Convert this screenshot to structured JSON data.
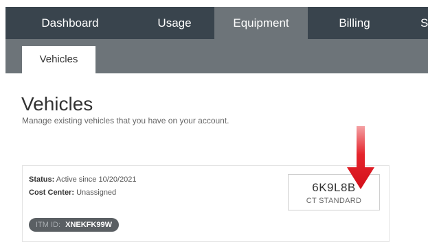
{
  "nav": {
    "tabs": [
      {
        "label": "Dashboard"
      },
      {
        "label": "Usage"
      },
      {
        "label": "Equipment",
        "active": true
      },
      {
        "label": "Billing"
      },
      {
        "label": "S"
      }
    ],
    "active_color": "#6d7479",
    "bar_color": "#39444d"
  },
  "subnav": {
    "tabs": [
      {
        "label": "Vehicles",
        "active": true
      }
    ]
  },
  "page": {
    "title": "Vehicles",
    "subtitle": "Manage existing vehicles that you have on your account."
  },
  "vehicle": {
    "status_label": "Status:",
    "status_value": "Active since 10/20/2021",
    "cost_center_label": "Cost Center:",
    "cost_center_value": "Unassigned",
    "plate": "6K9L8B",
    "plate_type": "CT STANDARD",
    "itm_label": "ITM ID:",
    "itm_value": "XNEKFK99W"
  },
  "annotation": {
    "arrow_icon": "red-down-arrow-icon",
    "color": "#e0121b"
  }
}
